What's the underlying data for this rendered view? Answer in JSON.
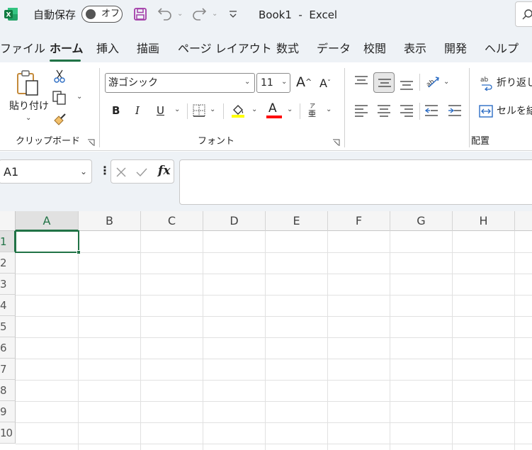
{
  "titlebar": {
    "autosave_label": "自動保存",
    "autosave_state": "オフ",
    "document_title": "Book1  -  Excel",
    "app_icon": "excel-logo-icon",
    "save_icon": "save-icon",
    "undo_icon": "undo-icon",
    "redo_icon": "redo-icon",
    "customize_icon": "customize-quick-access-icon",
    "search_icon": "search-icon"
  },
  "tabs": [
    {
      "label": "ファイル"
    },
    {
      "label": "ホーム"
    },
    {
      "label": "挿入"
    },
    {
      "label": "描画"
    },
    {
      "label": "ページ レイアウト"
    },
    {
      "label": "数式"
    },
    {
      "label": "データ"
    },
    {
      "label": "校閲"
    },
    {
      "label": "表示"
    },
    {
      "label": "開発"
    },
    {
      "label": "ヘルプ"
    }
  ],
  "ribbon": {
    "clipboard": {
      "paste_label": "貼り付け",
      "group_label": "クリップボード"
    },
    "font": {
      "font_name": "游ゴシック",
      "font_size": "11",
      "bold": "B",
      "italic": "I",
      "underline": "U",
      "font_color_glyph": "A",
      "grow_glyph": "A",
      "shrink_glyph": "A",
      "phonetic_top": "ア",
      "phonetic_bottom": "亜",
      "group_label": "フォント",
      "highlight_color": "#ffff00",
      "font_color": "#ff0000"
    },
    "alignment": {
      "wrap_text": "折り返し",
      "merge_center": "セルを結",
      "group_label": "配置"
    }
  },
  "formula_bar": {
    "name_box": "A1",
    "fx_label": "fx",
    "formula_value": ""
  },
  "grid": {
    "columns": [
      "A",
      "B",
      "C",
      "D",
      "E",
      "F",
      "G",
      "H"
    ],
    "rows": [
      "1",
      "2",
      "3",
      "4",
      "5",
      "6",
      "7",
      "8",
      "9",
      "10"
    ],
    "selected_cell": "A1",
    "accent_color": "#217346"
  }
}
